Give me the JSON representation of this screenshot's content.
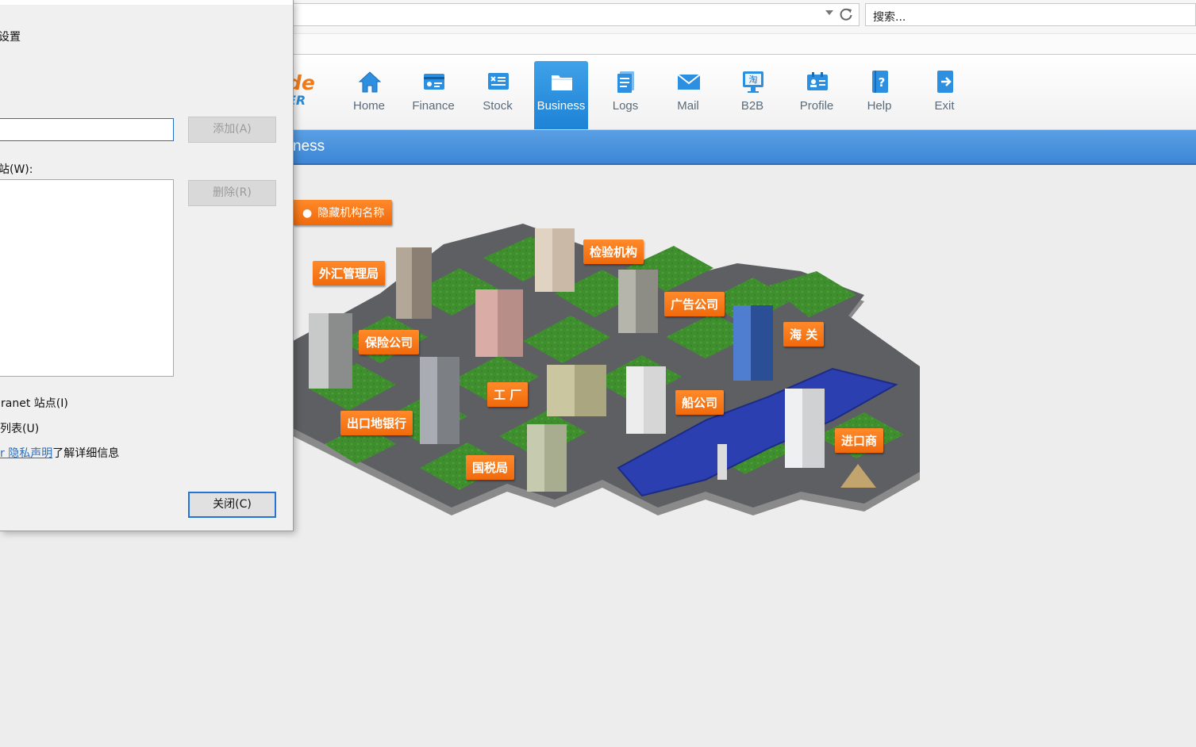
{
  "browser": {
    "search_placeholder": "搜索..."
  },
  "app": {
    "logo_line1": "de",
    "logo_line2": "ER",
    "nav": [
      {
        "label": "Home",
        "icon": "home-icon"
      },
      {
        "label": "Finance",
        "icon": "finance-icon"
      },
      {
        "label": "Stock",
        "icon": "stock-icon"
      },
      {
        "label": "Business",
        "icon": "folder-icon",
        "active": true
      },
      {
        "label": "Logs",
        "icon": "logs-icon"
      },
      {
        "label": "Mail",
        "icon": "mail-icon"
      },
      {
        "label": "B2B",
        "icon": "b2b-icon",
        "glyph": "淘"
      },
      {
        "label": "Profile",
        "icon": "profile-icon"
      },
      {
        "label": "Help",
        "icon": "help-icon",
        "glyph": "?"
      },
      {
        "label": "Exit",
        "icon": "exit-icon"
      }
    ],
    "section_title": "ness"
  },
  "map": {
    "hide_button": "隐藏机构名称",
    "labels": {
      "inspection": "检验机构",
      "forex": "外汇管理局",
      "advertising": "广告公司",
      "customs": "海 关",
      "insurance": "保险公司",
      "factory": "工 厂",
      "shipping": "船公司",
      "export_bank": "出口地银行",
      "importer": "进口商",
      "tax_bureau": "国税局"
    }
  },
  "dialog": {
    "title_fragment": "设置",
    "add_button": "添加(A)",
    "list_label": "站(W):",
    "remove_button": "删除(R)",
    "check1": "ranet 站点(I)",
    "check2": "列表(U)",
    "link_text": "r 隐私声明",
    "link_suffix": "了解详细信息",
    "close_button": "关闭(C)"
  },
  "colors": {
    "accent_blue": "#3c86d6",
    "tag_orange": "#f06a0c",
    "nav_text": "#5b6b7b"
  }
}
